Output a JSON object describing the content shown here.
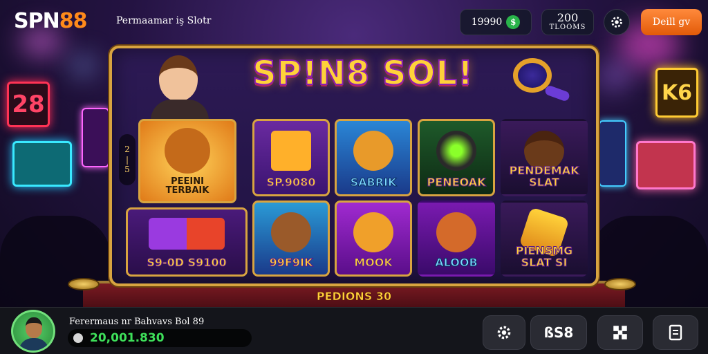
{
  "header": {
    "logo_part1": "SPN",
    "logo_part2": "88",
    "tagline": "Permaamar iş Slotr",
    "balance": "19990",
    "balance_icon": "coin-icon",
    "level_number": "200",
    "level_label": "TLOOMS",
    "deposit_label": "Deill gv"
  },
  "main": {
    "title": "SP!N8 SOL!",
    "side_level_top": "2",
    "side_level_bottom": "5",
    "side_level_sep": "|",
    "tiles": [
      {
        "label_line1": "PEEINI",
        "label_line2": "TERBAIK"
      },
      {
        "label_line1": "SP.9080",
        "label_line2": ""
      },
      {
        "label_line1": "SABRIK",
        "label_line2": ""
      },
      {
        "label_line1": "PENEOAK",
        "label_line2": ""
      },
      {
        "label_line1": "PENDEMAK",
        "label_line2": "SLAT"
      },
      {
        "label_line1": "S9-0D  S9100",
        "label_line2": ""
      },
      {
        "label_line1": "99F9IK",
        "label_line2": ""
      },
      {
        "label_line1": "MOOK",
        "label_line2": ""
      },
      {
        "label_line1": "ALOOB",
        "label_line2": ""
      },
      {
        "label_line1": "PIENSMG",
        "label_line2": "SLAT SI"
      }
    ],
    "footer_banner": "PEDIONS 30"
  },
  "backdrop": {
    "sign_left": "28",
    "sign_right": "K6"
  },
  "bottom": {
    "player_name": "Ferermaus nr Bahvavs Bol 89",
    "win_amount": "20,001.830",
    "spin_label": "ßS8"
  },
  "colors": {
    "accent_orange": "#ff8a1a",
    "gold": "#d8a440",
    "win_green": "#3ee05a"
  }
}
